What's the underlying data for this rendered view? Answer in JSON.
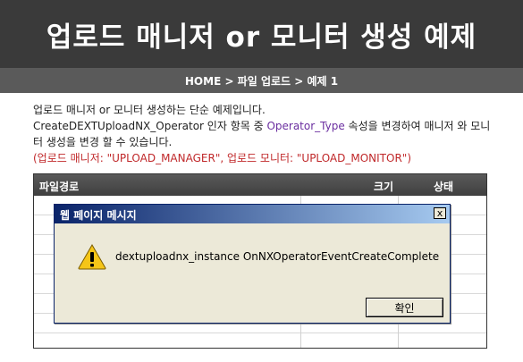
{
  "header": {
    "title": "업로드 매니저 or 모니터 생성 예제"
  },
  "breadcrumb": {
    "text": "HOME > 파일 업로드 > 예제 1"
  },
  "description": {
    "line1": "업로드 매니저 or 모니터 생성하는 단순 예제입니다.",
    "line2_prefix": "CreateDEXTUploadNX_Operator 인자 항목 중 ",
    "line2_highlight": "Operator_Type",
    "line2_suffix": " 속성을 변경하여 매니저 와 모니",
    "line3": "터 생성을 변경 할 수 있습니다.",
    "line4": "(업로드 매니저: \"UPLOAD_MANAGER\", 업로드 모니터: \"UPLOAD_MONITOR\")"
  },
  "table": {
    "columns": [
      "파일경로",
      "크기",
      "상태"
    ]
  },
  "dialog": {
    "title": "웹 페이지 메시지",
    "close": "x",
    "message": "dextuploadnx_instance OnNXOperatorEventCreateComplete",
    "ok_label": "확인",
    "icon": "warning-icon"
  }
}
